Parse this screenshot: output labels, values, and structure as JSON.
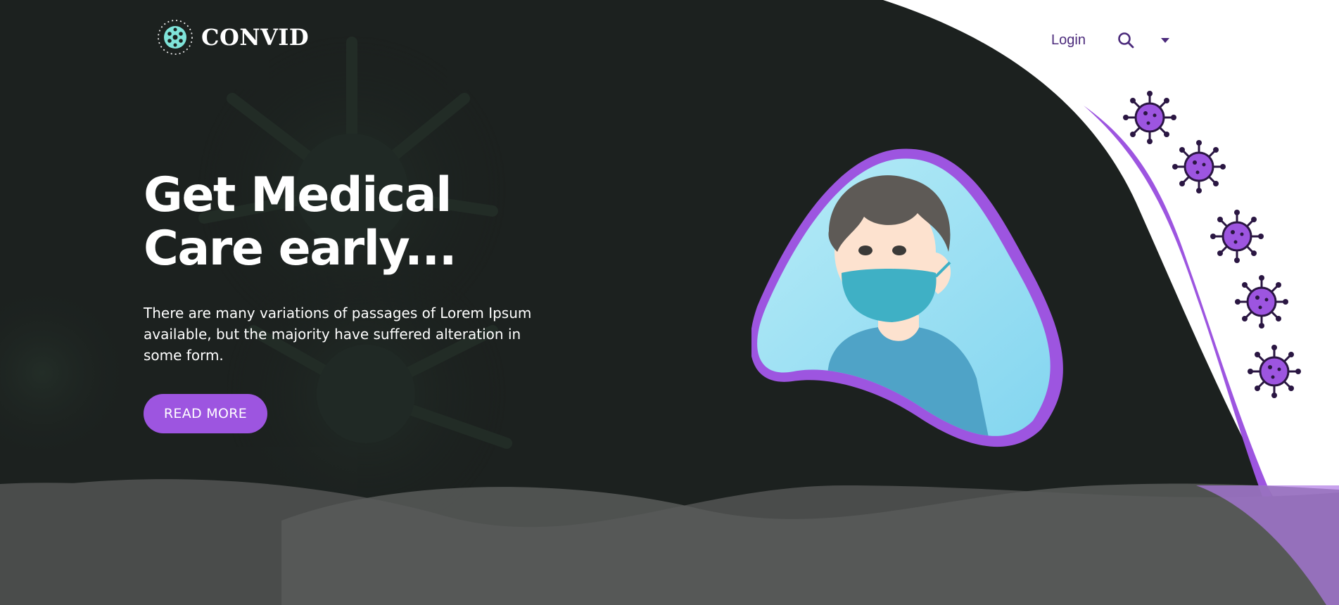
{
  "brand": {
    "name": "CONVID",
    "logo_icon": "virus-icon"
  },
  "nav": {
    "login_label": "Login",
    "search_icon": "search-icon",
    "dropdown_icon": "caret-down-icon"
  },
  "hero": {
    "title_line1": "Get Medical",
    "title_line2": "Care early...",
    "description": "There are many variations of passages of Lorem Ipsum available, but the majority have suffered alteration in some form.",
    "button_label": "READ MORE"
  },
  "illustration": {
    "subject": "sick person wearing face mask"
  },
  "colors": {
    "accent": "#9d55e0",
    "background": "#1c211f",
    "nav_text": "#4b2a7b",
    "wave": "#4a4c4b"
  }
}
